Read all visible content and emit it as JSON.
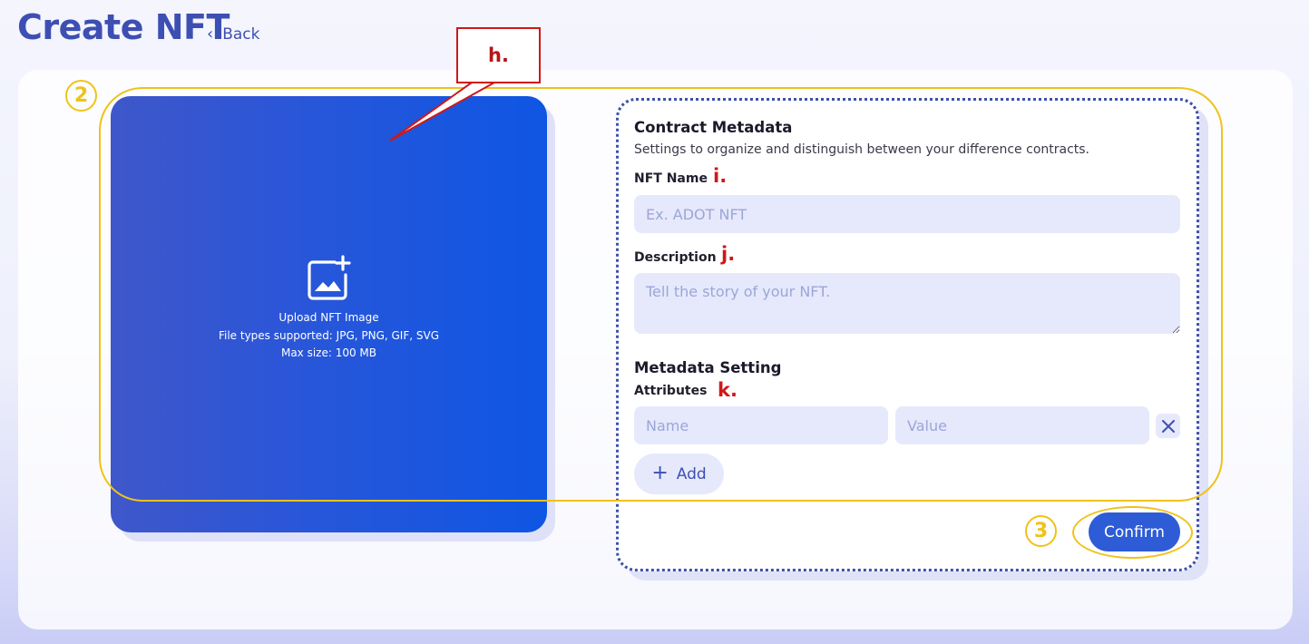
{
  "header": {
    "title": "Create NFT",
    "back_label": "Back",
    "back_icon": "chevron-left-icon"
  },
  "upload": {
    "icon": "add-image-icon",
    "line1": "Upload NFT Image",
    "line2": "File types supported: JPG, PNG, GIF, SVG",
    "line3": "Max size: 100 MB"
  },
  "form": {
    "title": "Contract Metadata",
    "subtitle": "Settings to organize and distinguish between your difference contracts.",
    "nft_name_label": "NFT Name",
    "nft_name_placeholder": "Ex. ADOT NFT",
    "nft_name_value": "",
    "description_label": "Description",
    "description_placeholder": "Tell the story of your NFT.",
    "description_value": "",
    "metadata_title": "Metadata Setting",
    "attributes_label": "Attributes",
    "attr_name_placeholder": "Name",
    "attr_value_placeholder": "Value",
    "remove_icon": "close-icon",
    "add_label": "Add",
    "confirm_label": "Confirm"
  },
  "annotations": {
    "callout_h": "h.",
    "mark_i": "i.",
    "mark_j": "j.",
    "mark_k": "k.",
    "step_2": "2",
    "step_3": "3"
  },
  "colors": {
    "accent": "#3d4fb2",
    "upload_gradient_start": "#3f57c9",
    "upload_gradient_end": "#0e56e3",
    "input_bg": "#e6e9fb",
    "confirm_bg": "#2e5bd6",
    "annotation_yellow": "#f0c21a",
    "annotation_red": "#d01818"
  }
}
